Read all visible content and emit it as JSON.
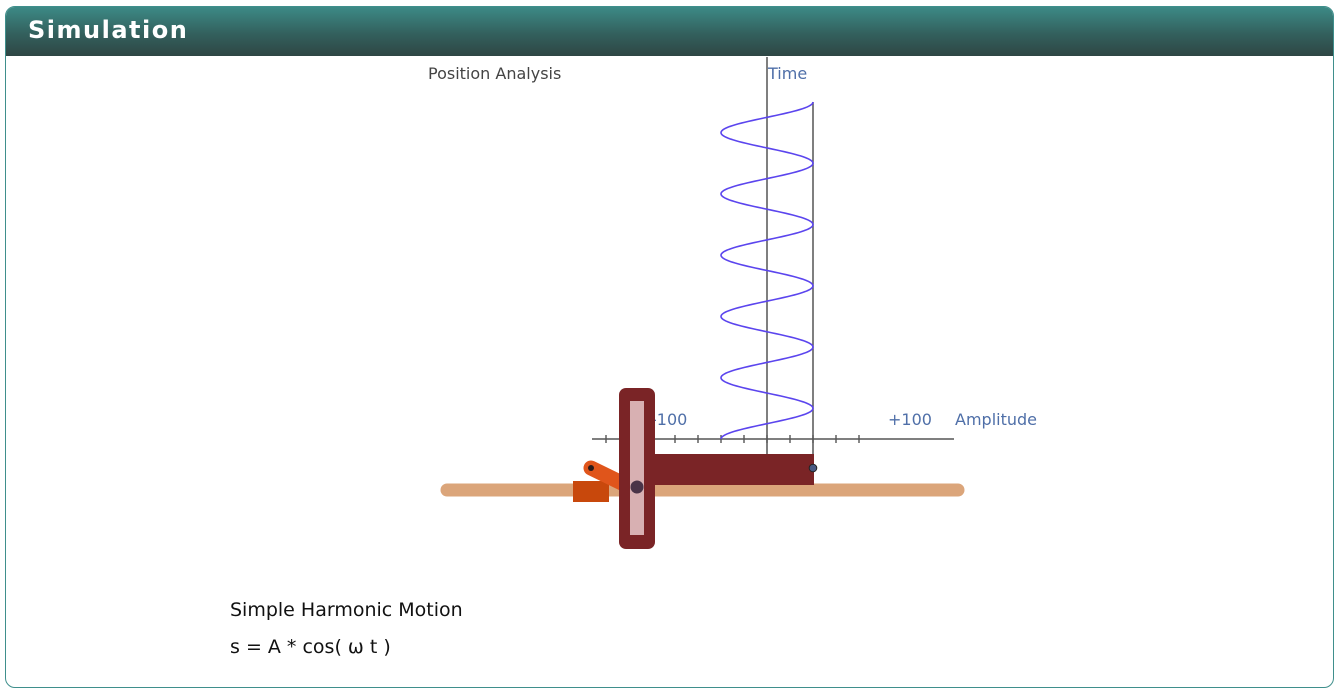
{
  "panel": {
    "title": "Simulation"
  },
  "simulation": {
    "graph_title": "Position Analysis",
    "time_axis_label": "Time",
    "amplitude_axis_label": "Amplitude",
    "min_label": "-100",
    "max_label": "+100",
    "amplitude_range": [
      -100,
      100
    ],
    "wave_cycles_visible": 5.5,
    "current_amplitude": 100,
    "colors": {
      "wave": "#5b45ee",
      "axis": "#555555",
      "axis_label": "#4f6fa8",
      "rail": "#dba57a",
      "slider_bar": "#7a2426",
      "slotted_yoke": "#7a2426",
      "crank": "#e0551b",
      "crank_block": "#c8480c"
    }
  },
  "caption": {
    "line1": "Simple Harmonic Motion",
    "line2": "s = A * cos( ω t )"
  }
}
